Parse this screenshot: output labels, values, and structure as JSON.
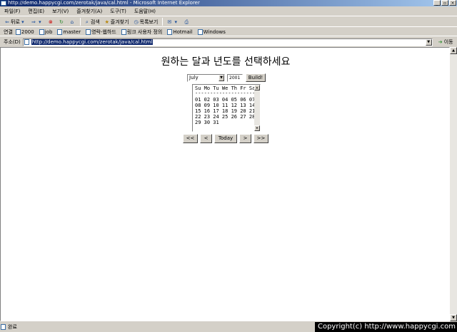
{
  "window": {
    "title": "http://demo.happycgi.com/zerotak/java/cal.html - Microsoft Internet Explorer",
    "buttons": [
      "_",
      "▫",
      "×"
    ]
  },
  "menu": [
    "파일(F)",
    "편집(E)",
    "보기(V)",
    "즐겨찾기(A)",
    "도구(T)",
    "도움말(H)"
  ],
  "toolbar": {
    "back": "뒤로",
    "search": "검색",
    "favorites": "즐겨찾기",
    "history": "목록보기"
  },
  "links": {
    "label": "연결",
    "items": [
      "2000",
      "job",
      "master",
      "영락-웹하드",
      "링크 사용자 정의",
      "Hotmail",
      "Windows"
    ]
  },
  "address": {
    "label": "주소(D)",
    "url": "http://demo.happycgi.com/zerotak/java/cal.html",
    "go": "이동"
  },
  "page": {
    "heading": "원하는 달과 년도를 선택하세요",
    "month_selected": "July",
    "year_value": "2001",
    "build_label": "Build!",
    "calendar_lines": [
      "Su Mo Tu We Th Fr Sa",
      "--------------------",
      "01 02 03 04 05 06 07",
      "08 09 10 11 12 13 14",
      "15 16 17 18 19 20 21",
      "22 23 24 25 26 27 28",
      "29 30 31"
    ],
    "nav": {
      "first": "<<",
      "prev": "<",
      "today": "Today",
      "next": ">",
      "last": ">>"
    }
  },
  "status": {
    "text": "완료"
  },
  "watermark": "Copyright(c) http://www.happycgi.com"
}
